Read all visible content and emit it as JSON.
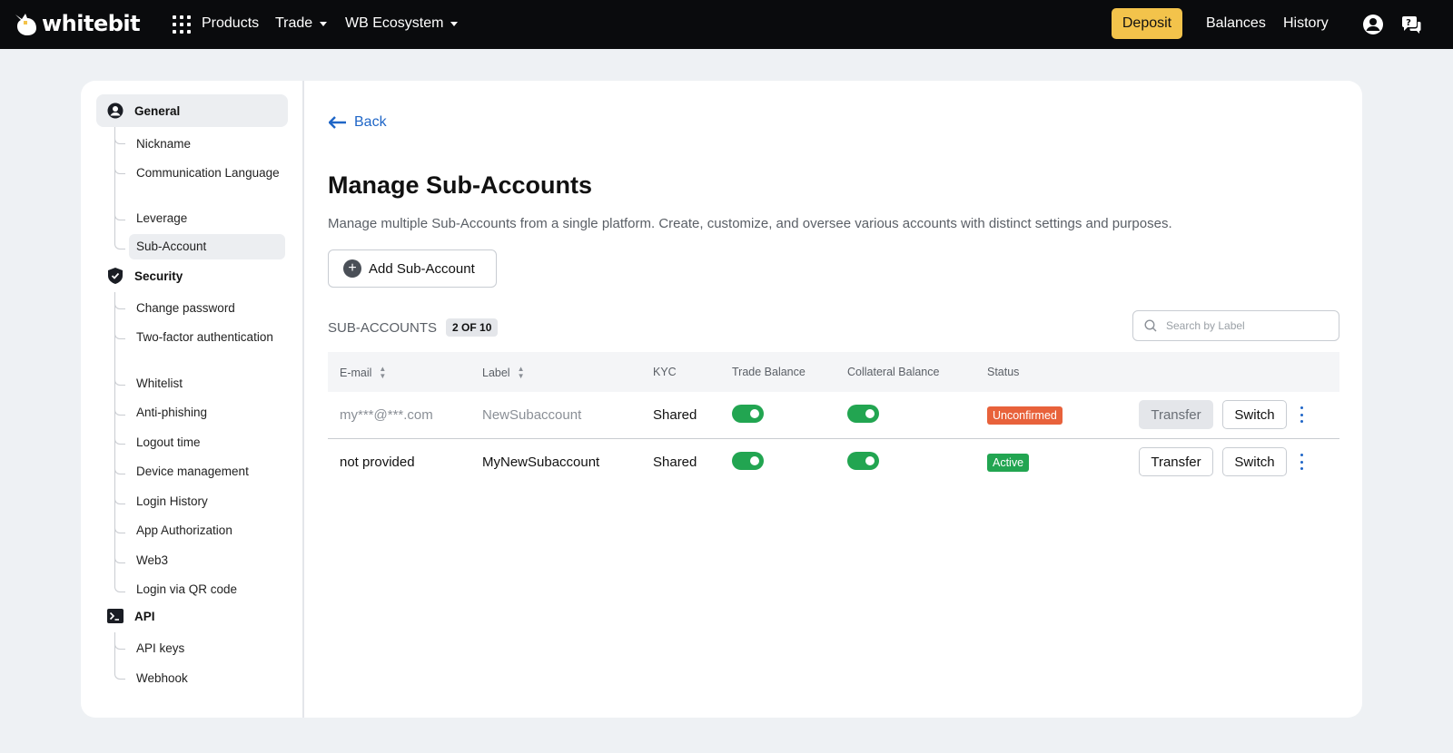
{
  "topbar": {
    "logo_text": "whitebit",
    "nav": [
      {
        "label": "Products",
        "dropdown": false
      },
      {
        "label": "Trade",
        "dropdown": true
      },
      {
        "label": "WB Ecosystem",
        "dropdown": true
      }
    ],
    "deposit_label": "Deposit",
    "balances_label": "Balances",
    "history_label": "History",
    "icons": [
      "grid-icon",
      "user-icon",
      "support-chat-icon"
    ],
    "accent_color": "#f3c34b"
  },
  "sidebar": {
    "sections": [
      {
        "label": "General",
        "icon": "user-circle-icon",
        "active": true,
        "items": [
          "Nickname",
          "Communication Language",
          "Leverage",
          "Sub-Account"
        ],
        "active_item": "Sub-Account"
      },
      {
        "label": "Security",
        "icon": "shield-icon",
        "active": false,
        "items": [
          "Change password",
          "Two-factor authentication",
          "Whitelist",
          "Anti-phishing",
          "Logout time",
          "Device management",
          "Login History",
          "App Authorization",
          "Web3",
          "Login via QR code"
        ]
      },
      {
        "label": "API",
        "icon": "terminal-icon",
        "active": false,
        "items": [
          "API keys",
          "Webhook"
        ]
      }
    ]
  },
  "main": {
    "back_label": "Back",
    "title": "Manage Sub-Accounts",
    "description": "Manage multiple Sub-Accounts from a single platform. Create, customize, and oversee various accounts with distinct settings and purposes.",
    "add_button_label": "Add Sub-Account",
    "list_heading": "SUB-ACCOUNTS",
    "count_badge": "2 OF 10",
    "search_placeholder": "Search by Label",
    "table": {
      "columns": [
        "E-mail",
        "Label",
        "KYC",
        "Trade Balance",
        "Collateral Balance",
        "Status"
      ],
      "rows": [
        {
          "email": "my***@***.com",
          "label": "NewSubaccount",
          "kyc": "Shared",
          "trade_balance": true,
          "collateral_balance": true,
          "status": "Unconfirmed",
          "transfer_label": "Transfer",
          "switch_label": "Switch",
          "transfer_disabled": true
        },
        {
          "email": "not provided",
          "label": "MyNewSubaccount",
          "kyc": "Shared",
          "trade_balance": true,
          "collateral_balance": true,
          "status": "Active",
          "transfer_label": "Transfer",
          "switch_label": "Switch",
          "transfer_disabled": false
        }
      ]
    },
    "status_colors": {
      "Unconfirmed": "#e8623b",
      "Active": "#22a551"
    },
    "toggle_color": "#22a551",
    "link_color": "#1f66c7"
  }
}
